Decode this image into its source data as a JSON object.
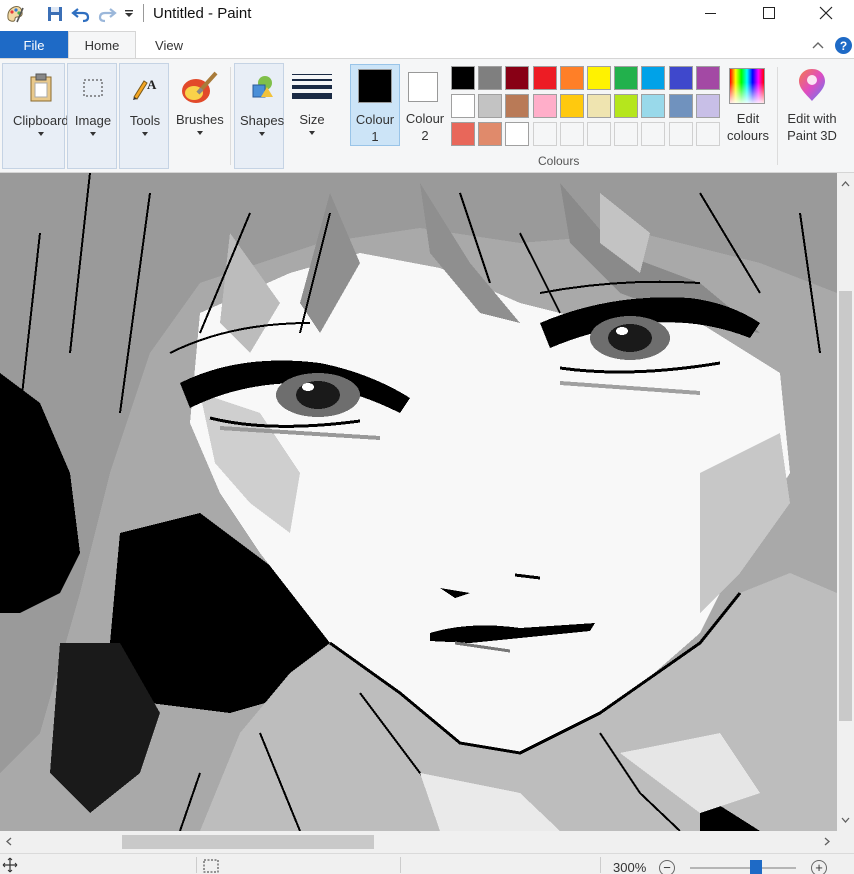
{
  "window": {
    "title": "Untitled - Paint",
    "controls": [
      "minimize",
      "maximize",
      "close"
    ]
  },
  "quick_access": {
    "items": [
      "paint-app-icon",
      "save-icon",
      "undo-icon",
      "redo-icon",
      "customize-quick-access-icon"
    ]
  },
  "tabs": {
    "file": "File",
    "home": "Home",
    "view": "View",
    "active": "Home"
  },
  "ribbon": {
    "clipboard": "Clipboard",
    "image": "Image",
    "tools": "Tools",
    "brushes": "Brushes",
    "shapes": "Shapes",
    "size": "Size",
    "colour1_line1": "Colour",
    "colour1_line2": "1",
    "colour2_line1": "Colour",
    "colour2_line2": "2",
    "colours_group": "Colours",
    "edit_colours_line1": "Edit",
    "edit_colours_line2": "colours",
    "paint3d_line1": "Edit with",
    "paint3d_line2": "Paint 3D"
  },
  "colours": {
    "colour1": "#000000",
    "colour2": "#ffffff",
    "palette_row1": [
      "#000000",
      "#7f7f7f",
      "#880015",
      "#ed1c24",
      "#ff7f27",
      "#fff200",
      "#22b14c",
      "#00a2e8",
      "#3f48cc",
      "#a349a4"
    ],
    "palette_row2": [
      "#ffffff",
      "#c3c3c3",
      "#b97a57",
      "#ffaec9",
      "#ffc90e",
      "#efe4b0",
      "#b5e61d",
      "#99d9ea",
      "#7092be",
      "#c8bfe7"
    ],
    "palette_row3": [
      "#e8675a",
      "#e08a6b",
      "#ffffff",
      "#f5f6f7",
      "#f5f6f7",
      "#f5f6f7",
      "#f5f6f7",
      "#f5f6f7",
      "#f5f6f7",
      "#f5f6f7"
    ]
  },
  "canvas": {
    "content": "pixelated grayscale manga-style drawing of a girl's face"
  },
  "statusbar": {
    "zoom": "300%",
    "zoom_level_fraction": 0.62
  }
}
